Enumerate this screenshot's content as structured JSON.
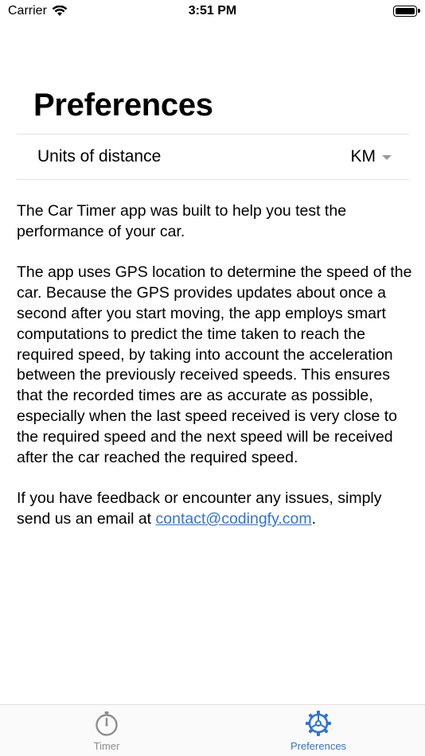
{
  "status_bar": {
    "carrier": "Carrier",
    "time": "3:51 PM"
  },
  "page": {
    "title": "Preferences"
  },
  "setting": {
    "label": "Units of distance",
    "value": "KM"
  },
  "description": {
    "paragraph1": "The Car Timer app was built to help you test the performance of your car.",
    "paragraph2": "The app uses GPS location to determine the speed of the car. Because the GPS provides updates about once a second after you start moving, the app employs smart computations to predict the time taken to reach the required speed, by taking into account the acceleration between the previously received speeds. This ensures that the recorded times are as accurate as possible, especially when the last speed received is very close to the required speed and the next speed will be received after the car reached the required speed.",
    "paragraph3_prefix": "If you have feedback or encounter any issues, simply send us an email at ",
    "email": "contact@codingfy.com",
    "paragraph3_suffix": "."
  },
  "tab_bar": {
    "tabs": [
      {
        "label": "Timer",
        "icon": "stopwatch-icon",
        "active": false
      },
      {
        "label": "Preferences",
        "icon": "gear-icon",
        "active": true
      }
    ]
  },
  "colors": {
    "accent": "#2f73d8",
    "inactive": "#8e8e8e"
  }
}
